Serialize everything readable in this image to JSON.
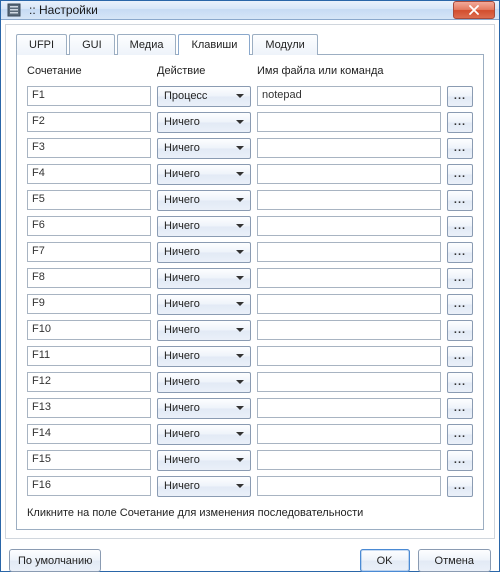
{
  "window": {
    "title": ":: Настройки"
  },
  "tabs": [
    {
      "label": "UFPI",
      "active": false
    },
    {
      "label": "GUI",
      "active": false
    },
    {
      "label": "Медиа",
      "active": false
    },
    {
      "label": "Клавиши",
      "active": true
    },
    {
      "label": "Модули",
      "active": false
    }
  ],
  "columns": {
    "combo": "Сочетание",
    "action": "Действие",
    "file": "Имя файла или команда"
  },
  "rows": [
    {
      "combo": "F1",
      "action": "Процесс",
      "file": "notepad"
    },
    {
      "combo": "F2",
      "action": "Ничего",
      "file": ""
    },
    {
      "combo": "F3",
      "action": "Ничего",
      "file": ""
    },
    {
      "combo": "F4",
      "action": "Ничего",
      "file": ""
    },
    {
      "combo": "F5",
      "action": "Ничего",
      "file": ""
    },
    {
      "combo": "F6",
      "action": "Ничего",
      "file": ""
    },
    {
      "combo": "F7",
      "action": "Ничего",
      "file": ""
    },
    {
      "combo": "F8",
      "action": "Ничего",
      "file": ""
    },
    {
      "combo": "F9",
      "action": "Ничего",
      "file": ""
    },
    {
      "combo": "F10",
      "action": "Ничего",
      "file": ""
    },
    {
      "combo": "F11",
      "action": "Ничего",
      "file": ""
    },
    {
      "combo": "F12",
      "action": "Ничего",
      "file": ""
    },
    {
      "combo": "F13",
      "action": "Ничего",
      "file": ""
    },
    {
      "combo": "F14",
      "action": "Ничего",
      "file": ""
    },
    {
      "combo": "F15",
      "action": "Ничего",
      "file": ""
    },
    {
      "combo": "F16",
      "action": "Ничего",
      "file": ""
    }
  ],
  "browse_label": "...",
  "hint": "Кликните на поле Сочетание для изменения последовательности",
  "buttons": {
    "defaults": "По умолчанию",
    "ok": "OK",
    "cancel": "Отмена"
  }
}
